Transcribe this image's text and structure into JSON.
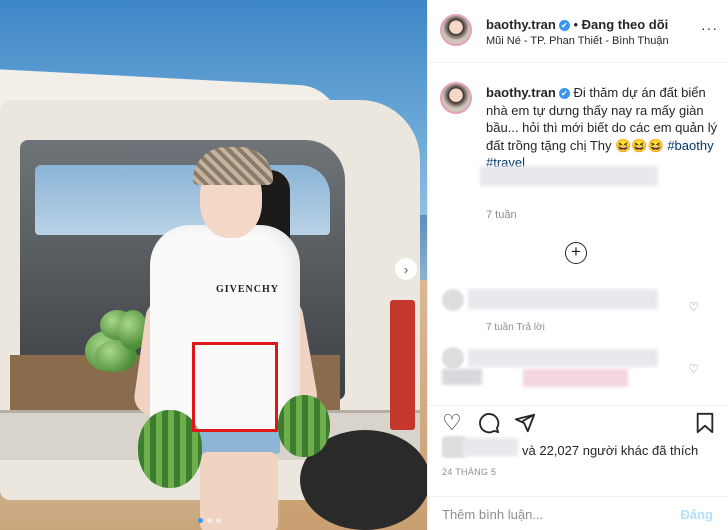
{
  "post": {
    "username": "baothy.tran",
    "verified_mark": "✔",
    "separator": "•",
    "follow_status": "Đang theo dõi",
    "location": "Mũi Né - TP. Phan Thiết - Bình Thuận",
    "more_icon": "more-horizontal-icon"
  },
  "photo": {
    "shirt_text": "GIVENCHY",
    "next_arrow_glyph": "›",
    "carousel_count": 3,
    "carousel_active_index": 0,
    "highlight_color": "#e0161b"
  },
  "caption": {
    "username": "baothy.tran",
    "text": "Đi thăm dự án đất biển nhà em tự dưng thấy nay ra mấy giàn bầu... hỏi thì mới biết do các em quản lý đất trồng tặng chị Thy",
    "emojis": "😆😆😆",
    "hashtags": [
      "#baothy",
      "#travel"
    ],
    "time": "7 tuần",
    "load_more_glyph": "+"
  },
  "comments": [
    {
      "meta": "7 tuần    Trả lời",
      "heart_icon": "heart-outline-icon"
    },
    {
      "meta": "",
      "heart_icon": "heart-outline-icon"
    }
  ],
  "actions": {
    "like_icon": "heart-icon",
    "comment_icon": "comment-icon",
    "share_icon": "share-icon",
    "save_icon": "bookmark-icon",
    "likes_text": "và 22,027 người khác đã thích",
    "date": "24 THÁNG 5"
  },
  "comment_input": {
    "placeholder": "Thêm bình luận...",
    "post_label": "Đăng"
  },
  "colors": {
    "link": "#00376b",
    "verified": "#3897f0",
    "post_button_disabled": "#b2dffc"
  }
}
